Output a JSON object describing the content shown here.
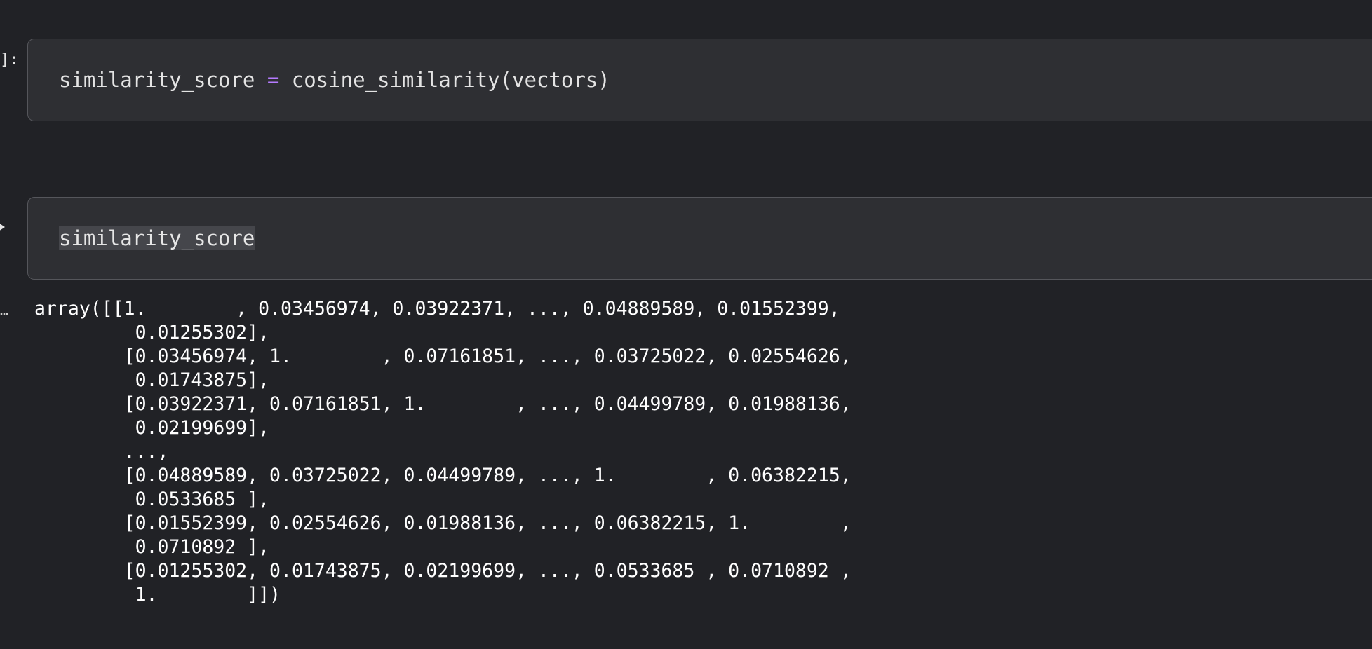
{
  "cells": [
    {
      "prompt": "]:",
      "code": {
        "lhs": "similarity_score",
        "operator": "=",
        "rhs": "cosine_similarity(vectors)"
      }
    },
    {
      "code": {
        "text": "similarity_score"
      },
      "output_prompt": "…",
      "output": "array([[1.        , 0.03456974, 0.03922371, ..., 0.04889589, 0.01552399,\n         0.01255302],\n        [0.03456974, 1.        , 0.07161851, ..., 0.03725022, 0.02554626,\n         0.01743875],\n        [0.03922371, 0.07161851, 1.        , ..., 0.04499789, 0.01988136,\n         0.02199699],\n        ...,\n        [0.04889589, 0.03725022, 0.04499789, ..., 1.        , 0.06382215,\n         0.0533685 ],\n        [0.01552399, 0.02554626, 0.01988136, ..., 0.06382215, 1.        ,\n         0.0710892 ],\n        [0.01255302, 0.01743875, 0.02199699, ..., 0.0533685 , 0.0710892 ,\n         1.        ]])"
    }
  ],
  "colors": {
    "background": "#212226",
    "cell_background": "#2e2f33",
    "operator": "#b57bff"
  }
}
